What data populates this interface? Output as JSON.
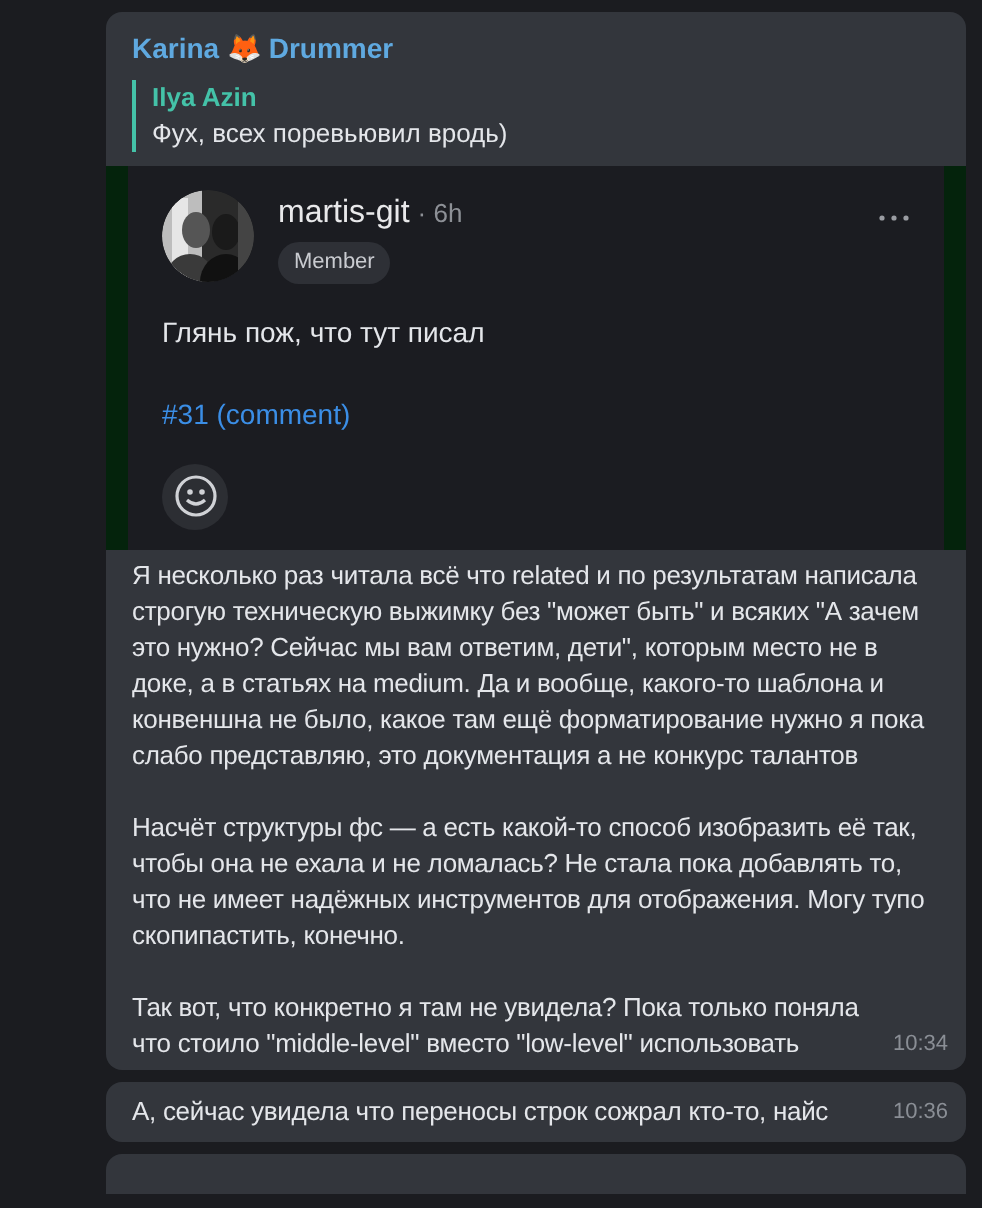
{
  "message": {
    "sender": "Karina 🦊 Drummer",
    "reply": {
      "author": "Ilya Azin",
      "text": "Фух, всех поревьювил вродь)"
    },
    "embed": {
      "author": "martis-git",
      "age": "· 6h",
      "role": "Member",
      "body": "Глянь пож, что тут писал",
      "link": "#31 (comment)"
    },
    "paragraphs": [
      "Я несколько раз читала всё что related и по результатам написала строгую техническую выжимку без \"может быть\" и всяких \"А зачем это нужно? Сейчас мы вам ответим, дети\", которым место не в доке, а в статьях на medium. Да и вообще, какого-то шаблона и конвеншна не было, какое там ещё форматирование нужно я пока слабо представляю, это документация а не конкурс талантов",
      "Насчёт структуры фс — а есть какой-то способ изобразить её так, чтобы она не ехала и не ломалась? Не стала пока добавлять то, что не имеет надёжных инструментов для отображения. Могу тупо скопипастить, конечно.",
      "Так вот, что конкретно я там не увидела? Пока только поняла что стоило \"middle-level\" вместо \"low-level\" использовать"
    ],
    "time": "10:34"
  },
  "followups": [
    {
      "text": "А, сейчас увидела что переносы строк сожрал кто-то, найс",
      "time": "10:36"
    }
  ]
}
